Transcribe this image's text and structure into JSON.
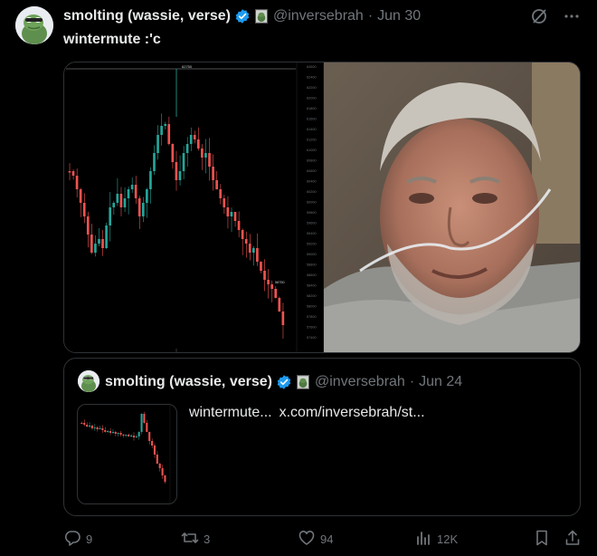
{
  "tweet": {
    "author_name": "smolting (wassie, verse)",
    "handle": "@inversebrah",
    "separator": "·",
    "date": "Jun 30",
    "text": "wintermute :'c"
  },
  "chart_readout": {
    "top_label": "62750",
    "price_label": "58750",
    "axis_ticks": [
      "62600",
      "62400",
      "62200",
      "62000",
      "61800",
      "61600",
      "61400",
      "61200",
      "61000",
      "60800",
      "60600",
      "60400",
      "60200",
      "60000",
      "59800",
      "59600",
      "59400",
      "59200",
      "59000",
      "58800",
      "58600",
      "58400",
      "58200",
      "58000",
      "57800",
      "57600",
      "57400"
    ]
  },
  "quote": {
    "author_name": "smolting (wassie, verse)",
    "handle": "@inversebrah",
    "separator": "·",
    "date": "Jun 24",
    "text": "wintermute...",
    "link": "x.com/inversebrah/st..."
  },
  "actions": {
    "replies": "9",
    "reposts": "3",
    "likes": "94",
    "views": "12K"
  },
  "icons": {
    "top": [
      "grok-icon",
      "more-icon"
    ],
    "actions": [
      "reply-icon",
      "repost-icon",
      "like-icon",
      "views-icon",
      "bookmark-icon",
      "share-icon"
    ]
  },
  "colors": {
    "background": "#000000",
    "text": "#e7e9ea",
    "muted": "#71767b",
    "border": "#2f3336",
    "verified": "#1d9bf0",
    "candle_up": "#26a69a",
    "candle_down": "#ef5350"
  }
}
